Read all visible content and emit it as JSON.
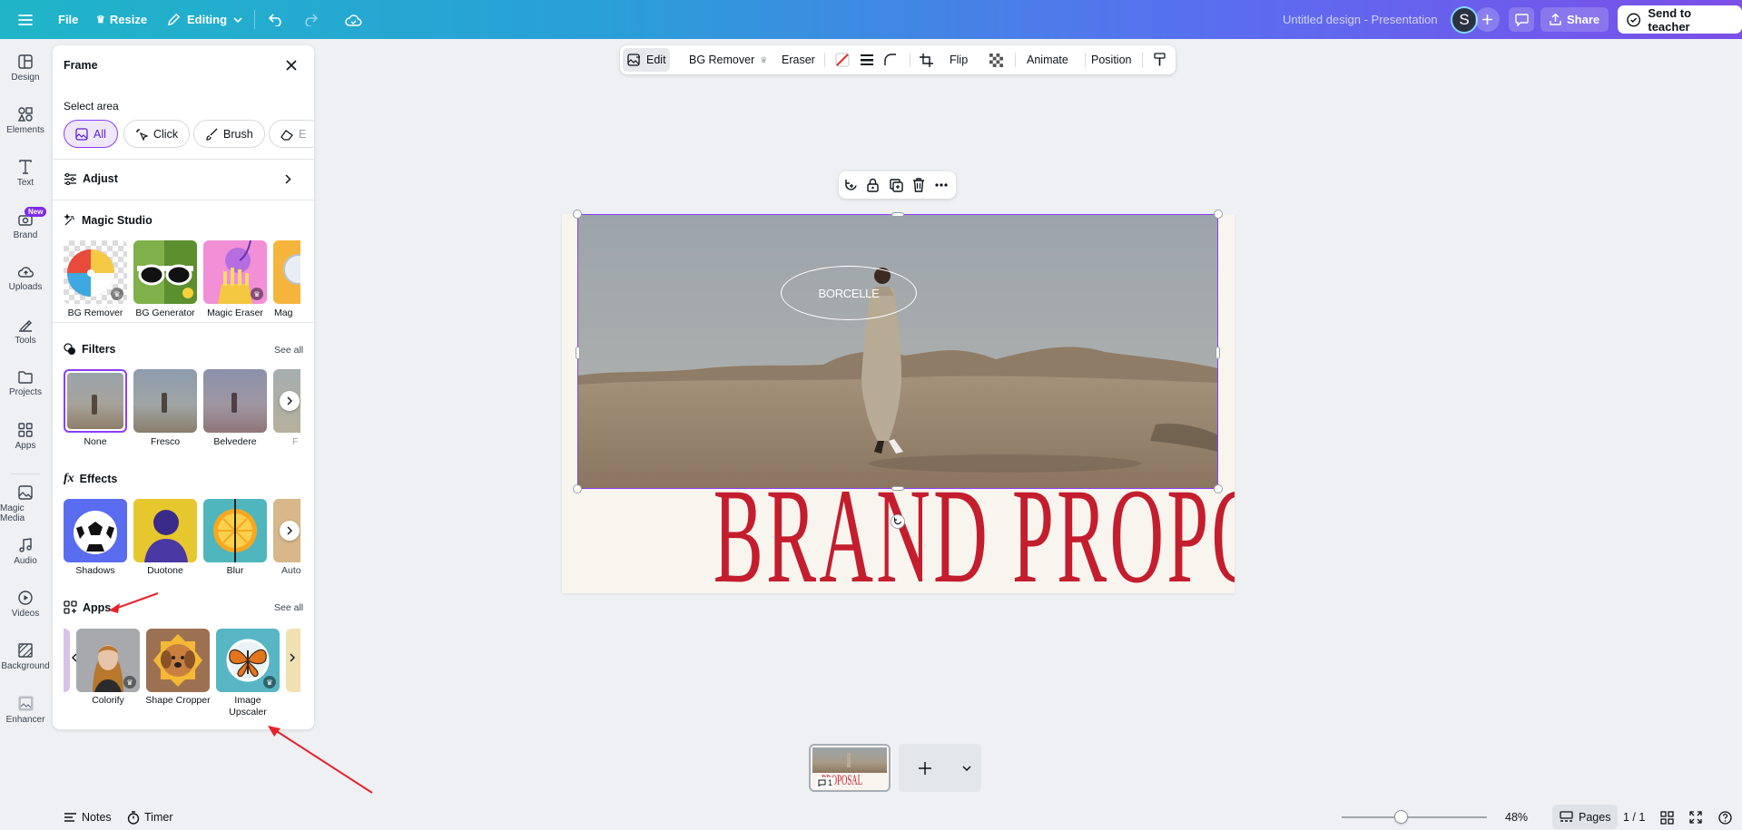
{
  "topbar": {
    "file_label": "File",
    "resize_label": "Resize",
    "editing_label": "Editing",
    "design_title": "Untitled design - Presentation",
    "avatar_letter": "S",
    "share_label": "Share",
    "send_label": "Send to teacher"
  },
  "rail": {
    "items": [
      {
        "label": "Design",
        "icon": "design-icon"
      },
      {
        "label": "Elements",
        "icon": "elements-icon"
      },
      {
        "label": "Text",
        "icon": "text-icon"
      },
      {
        "label": "Brand",
        "icon": "brand-icon",
        "badge": "New"
      },
      {
        "label": "Uploads",
        "icon": "uploads-icon"
      },
      {
        "label": "Tools",
        "icon": "tools-icon"
      },
      {
        "label": "Projects",
        "icon": "projects-icon"
      },
      {
        "label": "Apps",
        "icon": "apps-icon"
      },
      {
        "label": "Magic Media",
        "icon": "magic-media-icon"
      },
      {
        "label": "Audio",
        "icon": "audio-icon"
      },
      {
        "label": "Videos",
        "icon": "videos-icon"
      },
      {
        "label": "Background",
        "icon": "background-icon"
      },
      {
        "label": "Enhancer",
        "icon": "enhancer-icon"
      }
    ]
  },
  "panel": {
    "title": "Frame",
    "select_area_label": "Select area",
    "chips": [
      "All",
      "Click",
      "Brush",
      "E"
    ],
    "adjust_label": "Adjust",
    "magic_studio": {
      "title": "Magic Studio",
      "items": [
        "BG Remover",
        "BG Generator",
        "Magic Eraser",
        "Mag"
      ]
    },
    "filters": {
      "title": "Filters",
      "see_all": "See all",
      "items": [
        "None",
        "Fresco",
        "Belvedere",
        "F"
      ]
    },
    "effects": {
      "title": "Effects",
      "items": [
        "Shadows",
        "Duotone",
        "Blur",
        "Auto"
      ]
    },
    "apps": {
      "title": "Apps",
      "see_all": "See all",
      "items": [
        "Colorify",
        "Shape Cropper",
        "Image Upscaler"
      ]
    }
  },
  "context_toolbar": {
    "edit": "Edit",
    "bg_remover": "BG Remover",
    "eraser": "Eraser",
    "flip": "Flip",
    "animate": "Animate",
    "position": "Position"
  },
  "slide": {
    "logo_text": "BORCELLE",
    "headline": "BRAND PROPOSAL",
    "accent_color": "#c41e2e"
  },
  "bottom": {
    "notes": "Notes",
    "timer": "Timer",
    "zoom": "48%",
    "zoom_level": 0.48,
    "pages": "Pages",
    "page_count": "1 / 1",
    "thumb_number": "1"
  }
}
